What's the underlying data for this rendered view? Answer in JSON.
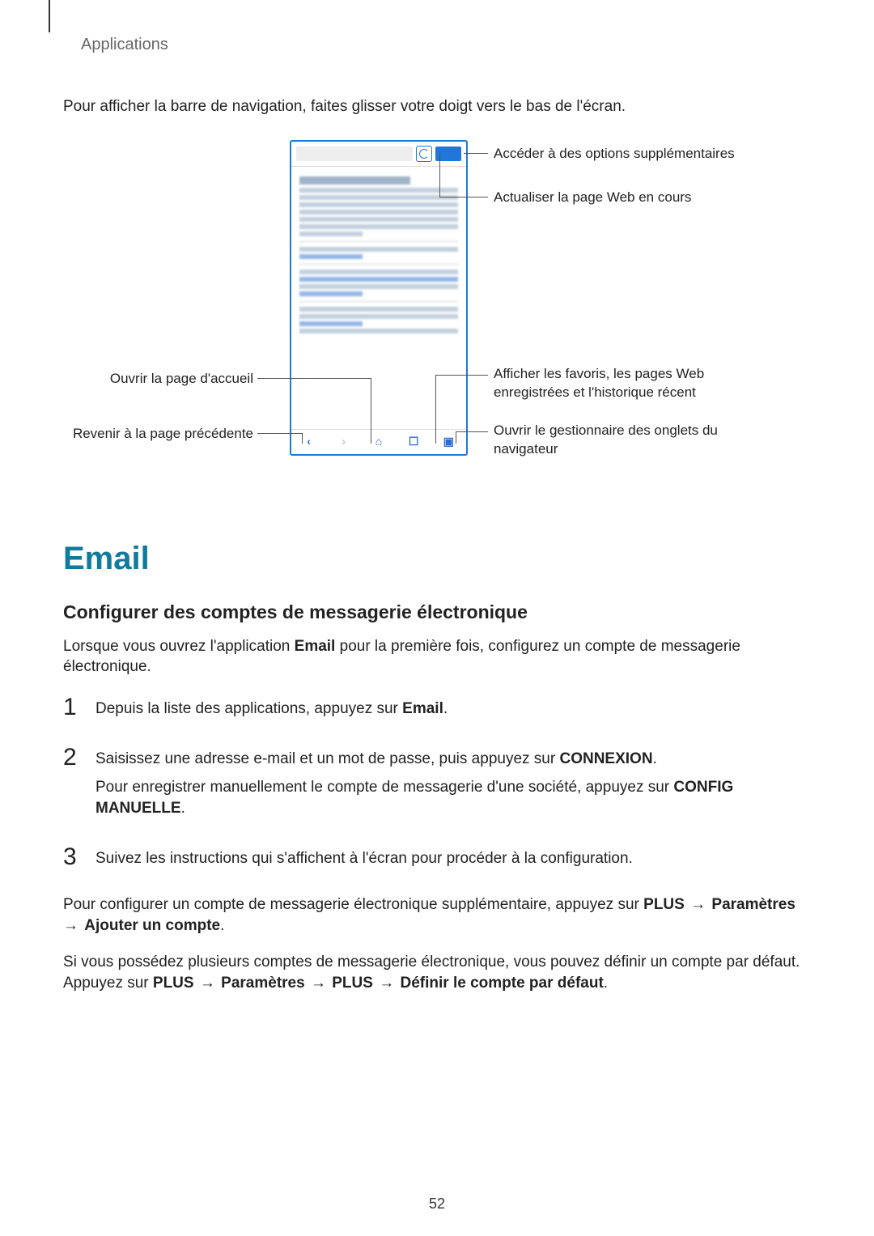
{
  "header": {
    "breadcrumb": "Applications"
  },
  "intro": "Pour afficher la barre de navigation, faites glisser votre doigt vers le bas de l'écran.",
  "callouts": {
    "more_options": "Accéder à des options supplémentaires",
    "refresh": "Actualiser la page Web en cours",
    "home": "Ouvrir la page d'accueil",
    "back": "Revenir à la page précédente",
    "favorites": "Afficher les favoris, les pages Web enregistrées et l'historique récent",
    "tabs": "Ouvrir le gestionnaire des onglets du navigateur"
  },
  "section": {
    "title": "Email",
    "subtitle": "Configurer des comptes de messagerie électronique",
    "lead_1a": "Lorsque vous ouvrez l'application ",
    "lead_1b_bold": "Email",
    "lead_1c": " pour la première fois, configurez un compte de messagerie électronique.",
    "step1_a": "Depuis la liste des applications, appuyez sur ",
    "step1_b_bold": "Email",
    "step1_c": ".",
    "step2_a": "Saisissez une adresse e-mail et un mot de passe, puis appuyez sur ",
    "step2_b_bold": "CONNEXION",
    "step2_c": ".",
    "step2_d": "Pour enregistrer manuellement le compte de messagerie d'une société, appuyez sur ",
    "step2_e_bold": "CONFIG MANUELLE",
    "step2_f": ".",
    "step3": "Suivez les instructions qui s'affichent à l'écran pour procéder à la configuration.",
    "after_a": "Pour configurer un compte de messagerie électronique supplémentaire, appuyez sur ",
    "after_b_bold": "PLUS",
    "after_c_arrow": " → ",
    "after_d_bold": "Paramètres",
    "after_e_arrow": " → ",
    "after_f_bold": "Ajouter un compte",
    "after_g": ".",
    "default_a": "Si vous possédez plusieurs comptes de messagerie électronique, vous pouvez définir un compte par défaut. Appuyez sur ",
    "default_b_bold": "PLUS",
    "default_c_arrow": " → ",
    "default_d_bold": "Paramètres",
    "default_e_arrow": " → ",
    "default_f_bold": "PLUS",
    "default_g_arrow": " → ",
    "default_h_bold": "Définir le compte par défaut",
    "default_i": "."
  },
  "nums": {
    "n1": "1",
    "n2": "2",
    "n3": "3"
  },
  "page_number": "52"
}
